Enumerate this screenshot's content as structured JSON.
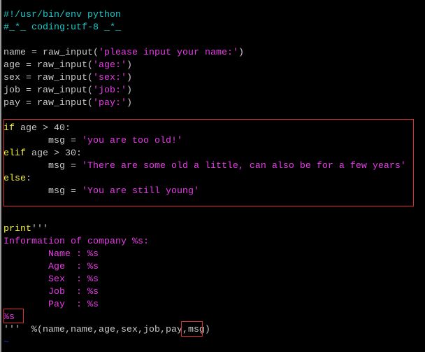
{
  "editor": {
    "colors": {
      "comment": "#1ec8c8",
      "normal": "#c8c8c8",
      "string": "#e63ce6",
      "keyword": "#f0f03c",
      "tilde": "#2030d0",
      "highlight": "#e03030"
    },
    "lines": [
      [
        [
          "#!/usr/bin/env python",
          "comment"
        ]
      ],
      [
        [
          "#_*_ coding:utf-8 _*_",
          "comment"
        ]
      ],
      [],
      [
        [
          "name = raw_input(",
          "normal"
        ],
        [
          "'please input your name:'",
          "string"
        ],
        [
          ")",
          "normal"
        ]
      ],
      [
        [
          "age = raw_input(",
          "normal"
        ],
        [
          "'age:'",
          "string"
        ],
        [
          ")",
          "normal"
        ]
      ],
      [
        [
          "sex = raw_input(",
          "normal"
        ],
        [
          "'sex:'",
          "string"
        ],
        [
          ")",
          "normal"
        ]
      ],
      [
        [
          "job = raw_input(",
          "normal"
        ],
        [
          "'job:'",
          "string"
        ],
        [
          ")",
          "normal"
        ]
      ],
      [
        [
          "pay = raw_input(",
          "normal"
        ],
        [
          "'pay:'",
          "string"
        ],
        [
          ")",
          "normal"
        ]
      ],
      [],
      [
        [
          "if",
          "keyword"
        ],
        [
          " age > 40:",
          "normal"
        ]
      ],
      [
        [
          "        msg = ",
          "normal"
        ],
        [
          "'you are too old!'",
          "string"
        ]
      ],
      [
        [
          "elif",
          "keyword"
        ],
        [
          " age > 30:",
          "normal"
        ]
      ],
      [
        [
          "        msg = ",
          "normal"
        ],
        [
          "'There are some old a little, can also be for a few years'",
          "string"
        ]
      ],
      [
        [
          "else",
          "keyword"
        ],
        [
          ":",
          "normal"
        ]
      ],
      [
        [
          "        msg = ",
          "normal"
        ],
        [
          "'You are still young'",
          "string"
        ]
      ],
      [],
      [],
      [
        [
          "print",
          "keyword"
        ],
        [
          "'''",
          "normal"
        ]
      ],
      [
        [
          "Information of company %s:",
          "string"
        ]
      ],
      [
        [
          "        Name : %s",
          "string"
        ]
      ],
      [
        [
          "        Age  : %s",
          "string"
        ]
      ],
      [
        [
          "        Sex  : %s",
          "string"
        ]
      ],
      [
        [
          "        Job  : %s",
          "string"
        ]
      ],
      [
        [
          "        Pay  : %s",
          "string"
        ]
      ],
      [
        [
          "%s",
          "string"
        ]
      ],
      [
        [
          "'''  %(name,name,age,sex,job,pay,msg)",
          "normal"
        ]
      ],
      [
        [
          "~",
          "tilde"
        ]
      ],
      [
        [
          "~",
          "tilde"
        ]
      ]
    ]
  }
}
